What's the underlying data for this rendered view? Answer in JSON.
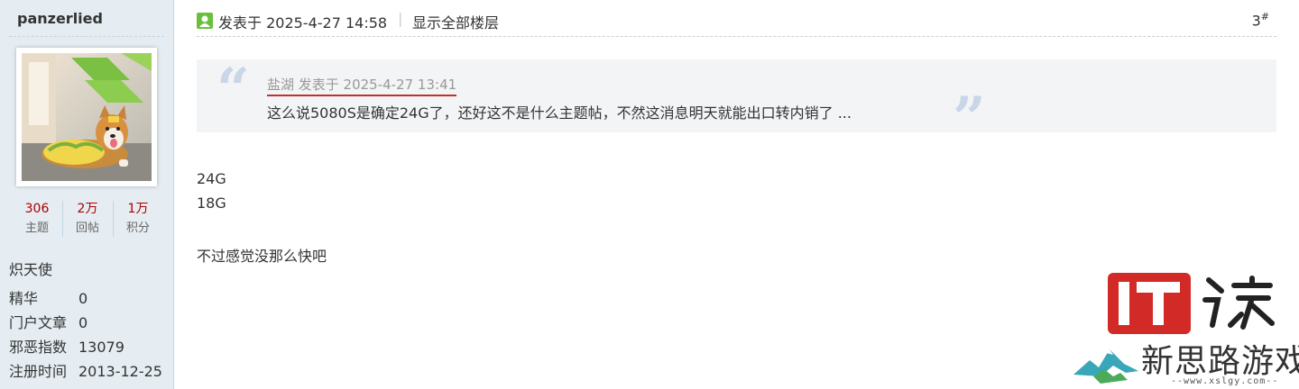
{
  "user": {
    "username": "panzerlied",
    "stats": [
      {
        "value": "306",
        "label": "主题"
      },
      {
        "value": "2万",
        "label": "回帖"
      },
      {
        "value": "1万",
        "label": "积分"
      }
    ],
    "rank": "炽天使",
    "info": [
      {
        "key": "精华",
        "value": "0"
      },
      {
        "key": "门户文章",
        "value": "0"
      },
      {
        "key": "邪恶指数",
        "value": "13079"
      },
      {
        "key": "注册时间",
        "value": "2013-12-25"
      }
    ]
  },
  "post": {
    "posted_at": "发表于 2025-4-27 14:58",
    "separator": "|",
    "show_all": "显示全部楼层",
    "floor": "3",
    "floor_suffix": "#",
    "quote": {
      "author_line": "盐湖 发表于 2025-4-27 13:41",
      "text": "这么说5080S是确定24G了，还好这不是什么主题帖，不然这消息明天就能出口转内销了 ..."
    },
    "body": [
      "24G",
      "18G",
      "不过感觉没那么快吧"
    ]
  },
  "watermark": {
    "logo": "IT",
    "logo_char": "之家",
    "site_name": "新思路游戏",
    "url": "--www.xslgy.com--"
  },
  "colors": {
    "sidebar_bg": "#e5edf2",
    "stat_value": "#a00000",
    "quote_bg": "#f3f4f6",
    "quote_mark": "#c9d6e8",
    "quote_underline": "#c0302c",
    "logo_red": "#d22b27"
  }
}
